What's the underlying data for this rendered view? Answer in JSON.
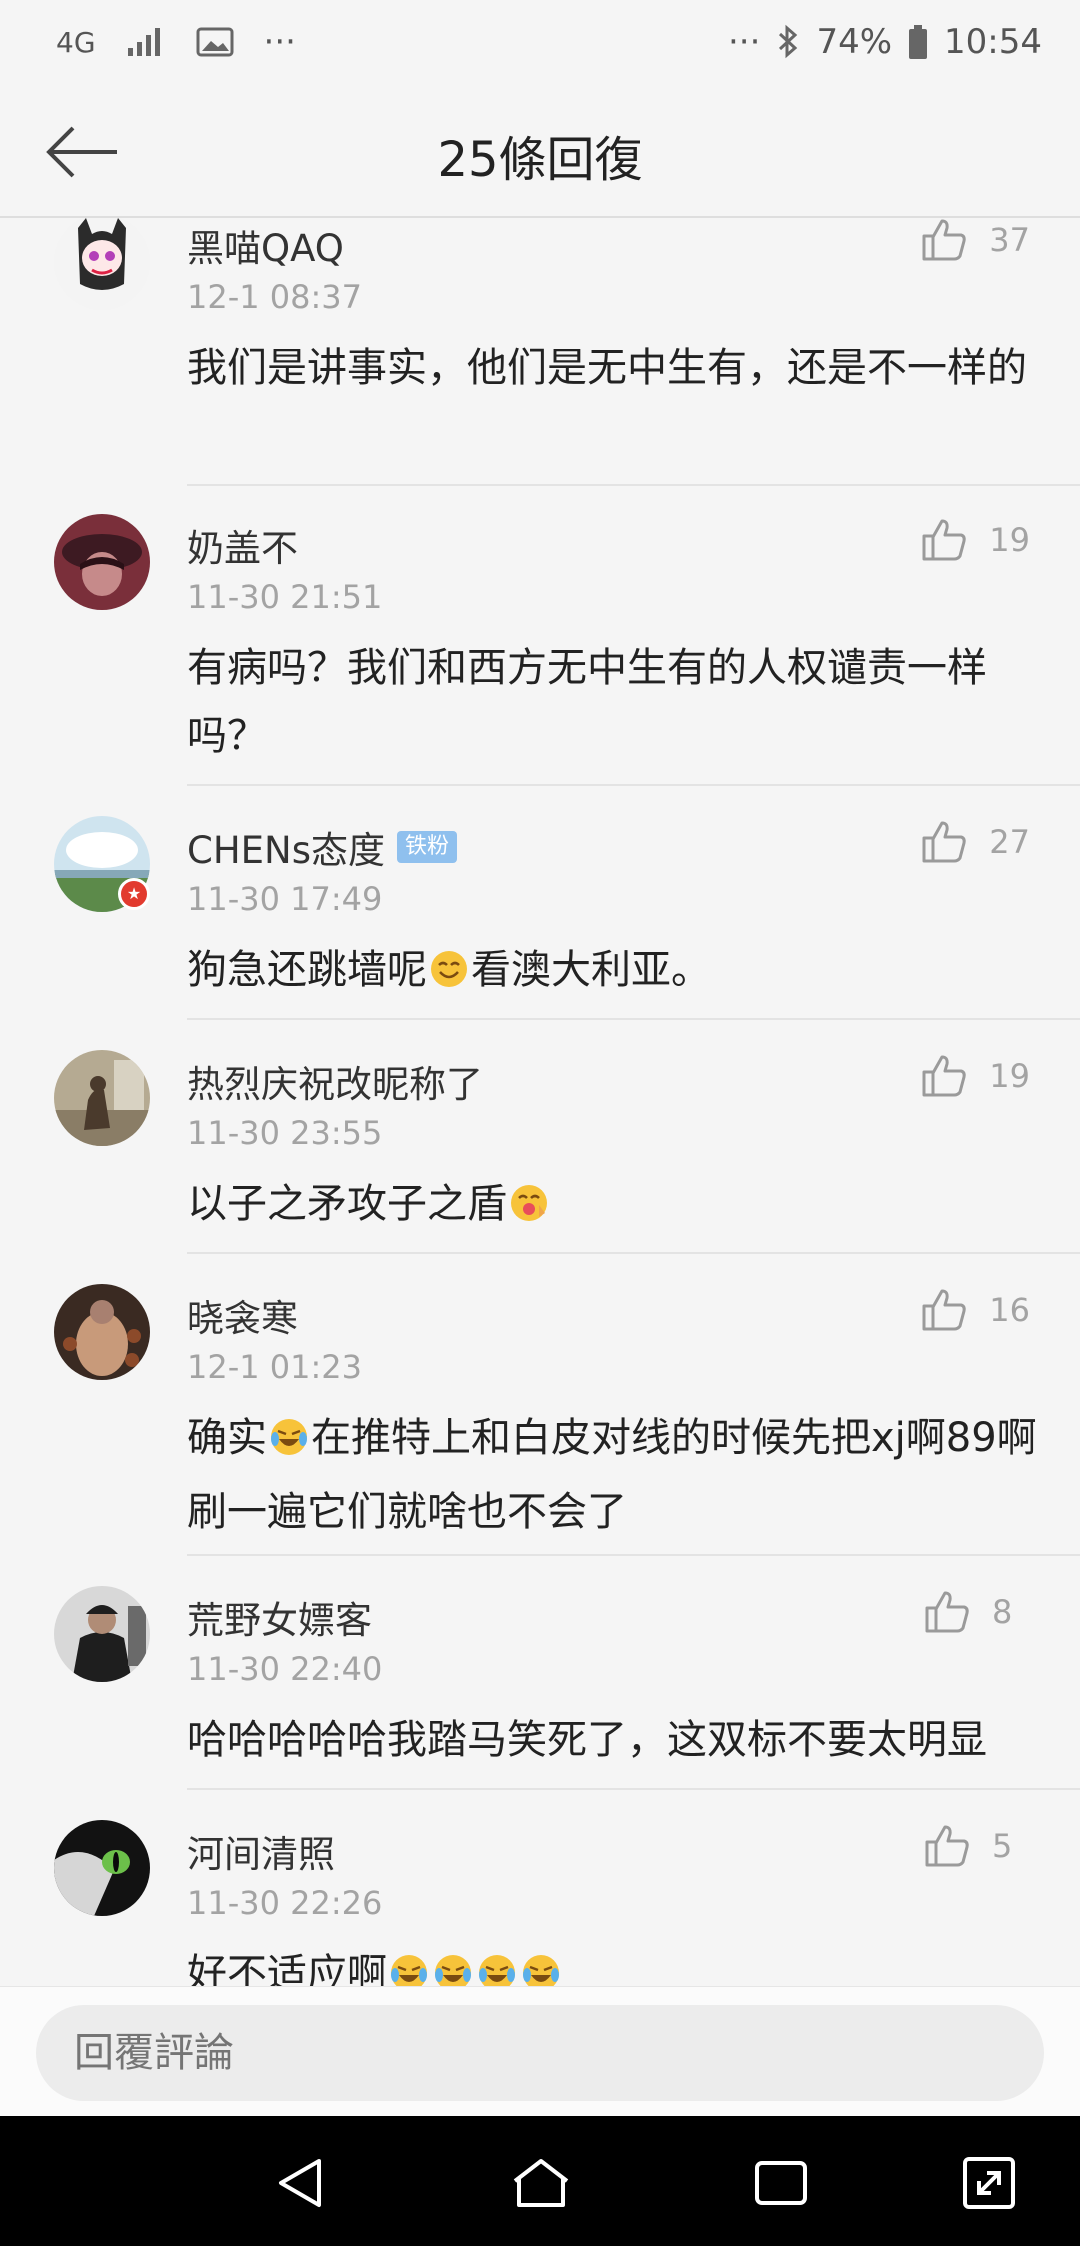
{
  "status_bar": {
    "network": "4G",
    "dots_left": "···",
    "dots_right": "···",
    "battery": "74%",
    "time": "10:54"
  },
  "header": {
    "title": "25條回復"
  },
  "comments": [
    {
      "username": "黑喵QAQ",
      "time": "12-1 08:37",
      "likes": "37",
      "text": "我们是讲事实，他们是无中生有，还是不一样的"
    },
    {
      "username": "奶盖不",
      "time": "11-30 21:51",
      "likes": "19",
      "text": "有病吗？我们和西方无中生有的人权谴责一样吗？"
    },
    {
      "username": "CHENs态度",
      "badge": "铁粉",
      "time": "11-30 17:49",
      "likes": "27",
      "text_a": "狗急还跳墙呢",
      "text_b": "看澳大利亚。"
    },
    {
      "username": "热烈庆祝改昵称了",
      "time": "11-30 23:55",
      "likes": "19",
      "text": "以子之矛攻子之盾"
    },
    {
      "username": "晓衾寒",
      "time": "12-1 01:23",
      "likes": "16",
      "text_a": "确实",
      "text_b": "在推特上和白皮对线的时候先把xj啊89啊刷一遍它们就啥也不会了"
    },
    {
      "username": "荒野女嫖客",
      "time": "11-30 22:40",
      "likes": "8",
      "text": "哈哈哈哈哈我踏马笑死了，这双标不要太明显"
    },
    {
      "username": "河间清照",
      "time": "11-30 22:26",
      "likes": "5",
      "text": "好不适应啊"
    }
  ],
  "reply_input": {
    "placeholder": "回覆評論"
  }
}
